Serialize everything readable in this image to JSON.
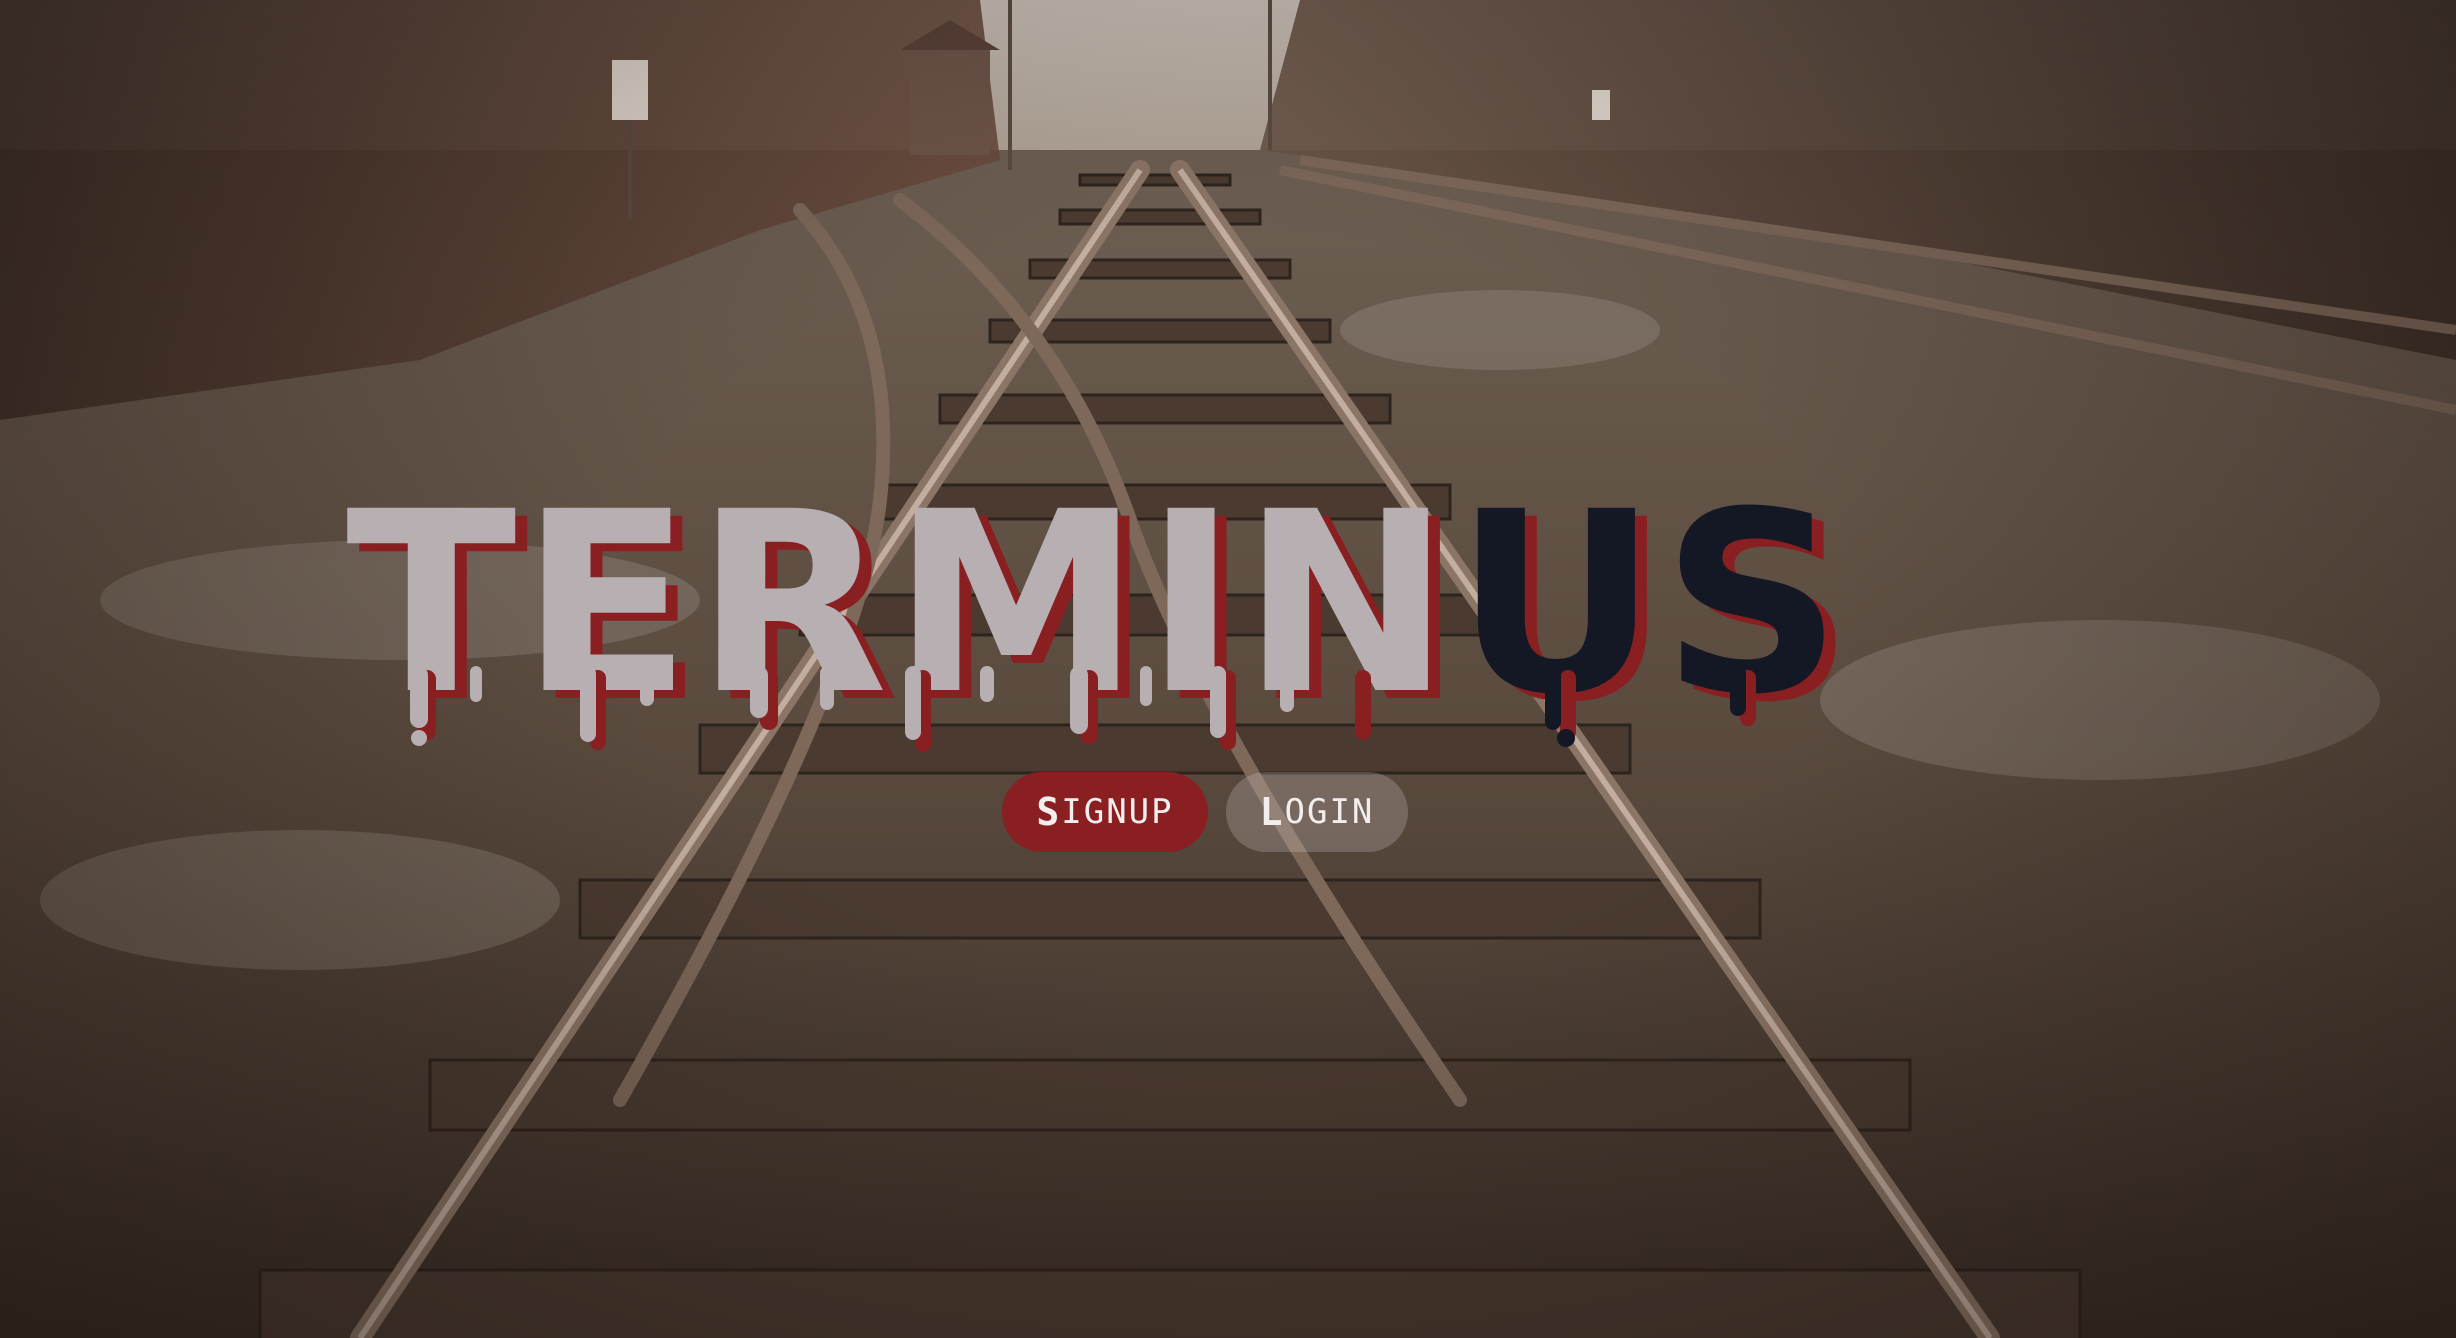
{
  "hero": {
    "title_part1": "TERMIN",
    "title_part2": "US",
    "title_part1_color": "#b8afb2",
    "title_part2_color": "#141724",
    "drip_shadow_color": "#8a1f22"
  },
  "buttons": {
    "signup_first": "S",
    "signup_rest": "IGNUP",
    "login_first": "L",
    "login_rest": "OGIN",
    "signup_color": "#8a1f22"
  },
  "background": {
    "description_icon": "railway-tracks-photo",
    "tone": "#5a4a3e"
  }
}
